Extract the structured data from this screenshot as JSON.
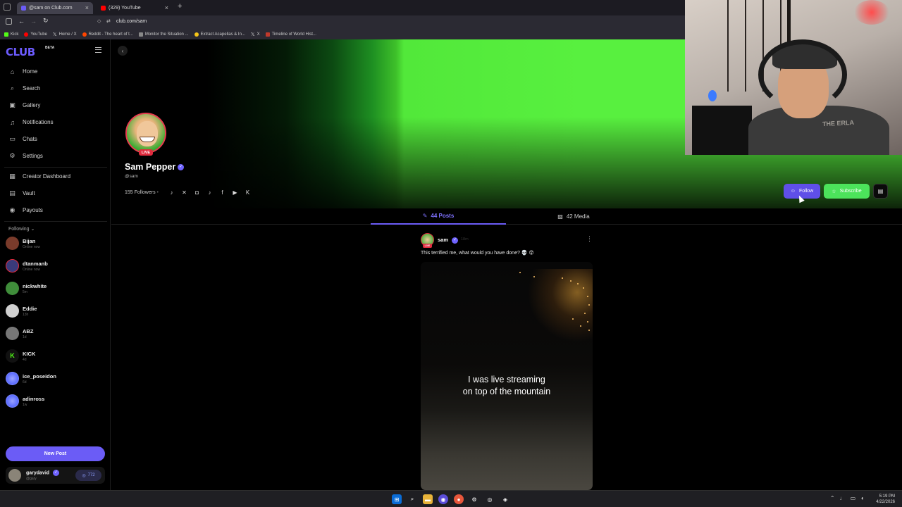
{
  "browser": {
    "tabs": [
      {
        "title": "@sam on Club.com",
        "active": true
      },
      {
        "title": "(329) YouTube",
        "active": false
      }
    ],
    "url": "club.com/sam",
    "bookmarks": [
      "Kick",
      "YouTube",
      "Home / X",
      "Reddit - The heart of t...",
      "Monitor the Situation ...",
      "Extract Acapellas & In...",
      "X",
      "Timeline of World Hist..."
    ]
  },
  "sidebar": {
    "logo": "CLUB",
    "beta": "BETA",
    "nav": [
      {
        "label": "Home",
        "icon": "home-icon"
      },
      {
        "label": "Search",
        "icon": "search-icon"
      },
      {
        "label": "Gallery",
        "icon": "gallery-icon"
      },
      {
        "label": "Notifications",
        "icon": "bell-icon"
      },
      {
        "label": "Chats",
        "icon": "chat-icon"
      },
      {
        "label": "Settings",
        "icon": "gear-icon"
      }
    ],
    "nav2": [
      {
        "label": "Creator Dashboard",
        "icon": "dashboard-icon"
      },
      {
        "label": "Vault",
        "icon": "vault-icon"
      },
      {
        "label": "Payouts",
        "icon": "payouts-icon"
      }
    ],
    "following_label": "Following",
    "following": [
      {
        "name": "Bijan",
        "status": "Online now",
        "color": "#7a3b2b",
        "live": false
      },
      {
        "name": "dtanmanb",
        "status": "Online now",
        "color": "#3a3a7a",
        "live": true
      },
      {
        "name": "nickwhite",
        "status": "5m",
        "color": "#3f8d3a",
        "live": false
      },
      {
        "name": "Eddie",
        "status": "13h",
        "color": "#d0d0d0",
        "live": false
      },
      {
        "name": "ABZ",
        "status": "1d",
        "color": "#777777",
        "live": false
      },
      {
        "name": "KICK",
        "status": "4d",
        "color": "#1a1a1a",
        "live": false
      },
      {
        "name": "ice_poseidon",
        "status": "6d",
        "color": "#5b6cff",
        "live": false
      },
      {
        "name": "adinross",
        "status": "1w",
        "color": "#5b6cff",
        "live": false
      }
    ],
    "new_post": "New Post",
    "me": {
      "name": "garydavid",
      "handle": "@gary",
      "points": "772"
    }
  },
  "profile": {
    "name": "Sam Pepper",
    "handle": "@sam",
    "followers": "155 Followers",
    "live_badge": "LIVE",
    "follow_label": "Follow",
    "subscribe_label": "Subscribe",
    "socials": [
      "bell-icon",
      "x-icon",
      "instagram-icon",
      "tiktok-icon",
      "facebook-icon",
      "youtube-icon",
      "kick-icon"
    ]
  },
  "webcam": {
    "shirt_text": "THE ERLA"
  },
  "tabs": {
    "posts": "44 Posts",
    "media": "42 Media"
  },
  "post": {
    "user": "sam",
    "time": "18m",
    "text": "This terrified me, what would you have done? 💀 😵",
    "live": "LIVE",
    "caption_line1": "I was live streaming",
    "caption_line2": "on top of the mountain"
  },
  "taskbar": {
    "time": "5:19 PM",
    "date": "4/22/2026"
  },
  "colors": {
    "accent": "#6b5cf6",
    "subscribe": "#4ce35b",
    "live": "#e02b3e",
    "banner_green": "#58f03f"
  }
}
